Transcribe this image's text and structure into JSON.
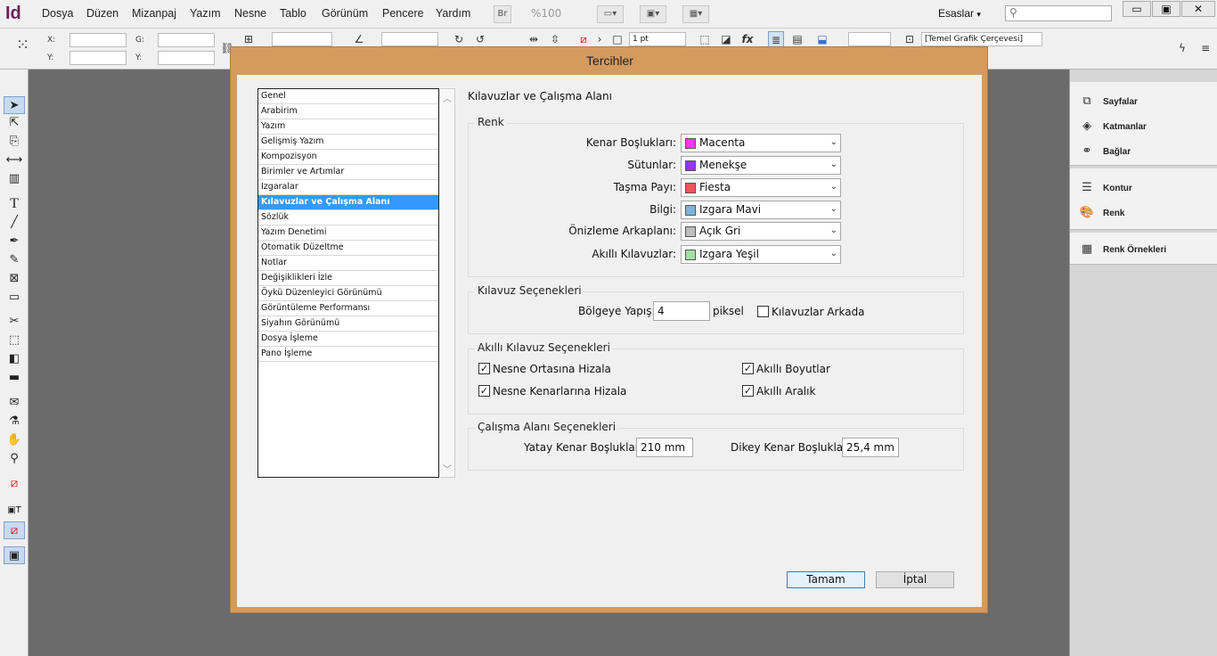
{
  "menubar": {
    "logo": "Id",
    "items": [
      "Dosya",
      "Düzen",
      "Mizanpaj",
      "Yazım",
      "Nesne",
      "Tablo",
      "Görünüm",
      "Pencere",
      "Yardım"
    ],
    "bridge_label": "Br",
    "zoom": "%100",
    "workspace": "Esaslar",
    "window_buttons": [
      "▭",
      "▣",
      "✕"
    ]
  },
  "control": {
    "x_label": "X:",
    "y_label": "Y:",
    "w_label": "G:",
    "h_label": "Y:",
    "stroke_weight": "1 pt",
    "frame_style": "[Temel Grafik Çerçevesi]"
  },
  "right_panel": {
    "group1": [
      "Sayfalar",
      "Katmanlar",
      "Bağlar"
    ],
    "group2": [
      "Kontur",
      "Renk"
    ],
    "group3": [
      "Renk Örnekleri"
    ]
  },
  "dialog": {
    "title": "Tercihler",
    "categories": [
      "Genel",
      "Arabirim",
      "Yazım",
      "Gelişmiş Yazım",
      "Kompozisyon",
      "Birimler ve Artımlar",
      "Izgaralar",
      "Kılavuzlar ve Çalışma Alanı",
      "Sözlük",
      "Yazım Denetimi",
      "Otomatik Düzeltme",
      "Notlar",
      "Değişiklikleri İzle",
      "Öykü Düzenleyici Görünümü",
      "Görüntüleme Performansı",
      "Siyahın Görünümü",
      "Dosya İşleme",
      "Pano İşleme"
    ],
    "selected_category": 7,
    "section_title": "Kılavuzlar ve Çalışma Alanı",
    "color_group": {
      "label": "Renk",
      "rows": [
        {
          "label": "Kenar Boşlukları:",
          "value": "Macenta",
          "color": "#ff33ff"
        },
        {
          "label": "Sütunlar:",
          "value": "Menekşe",
          "color": "#9933ff"
        },
        {
          "label": "Taşma Payı:",
          "value": "Fiesta",
          "color": "#f2545b"
        },
        {
          "label": "Bilgi:",
          "value": "Izgara Mavi",
          "color": "#7ab4d8"
        },
        {
          "label": "Önizleme Arkaplanı:",
          "value": "Açık Gri",
          "color": "#bdbdbd"
        },
        {
          "label": "Akıllı Kılavuzlar:",
          "value": "Izgara Yeşil",
          "color": "#a3e0a3"
        }
      ]
    },
    "guide_options": {
      "label": "Kılavuz Seçenekleri",
      "snap_label": "Bölgeye Yapış:",
      "snap_value": "4",
      "snap_unit": "piksel",
      "guides_back_label": "Kılavuzlar Arkada",
      "guides_back_checked": false
    },
    "smart_guides": {
      "label": "Akıllı Kılavuz Seçenekleri",
      "options": [
        {
          "label": "Nesne Ortasına Hizala",
          "checked": true
        },
        {
          "label": "Nesne Kenarlarına Hizala",
          "checked": true
        },
        {
          "label": "Akıllı Boyutlar",
          "checked": true
        },
        {
          "label": "Akıllı Aralık",
          "checked": true
        }
      ]
    },
    "workspace_options": {
      "label": "Çalışma Alanı Seçenekleri",
      "h_label": "Yatay Kenar Boşlukları:",
      "h_value": "210 mm",
      "v_label": "Dikey Kenar Boşlukları:",
      "v_value": "25,4 mm"
    },
    "ok_label": "Tamam",
    "cancel_label": "İptal"
  }
}
